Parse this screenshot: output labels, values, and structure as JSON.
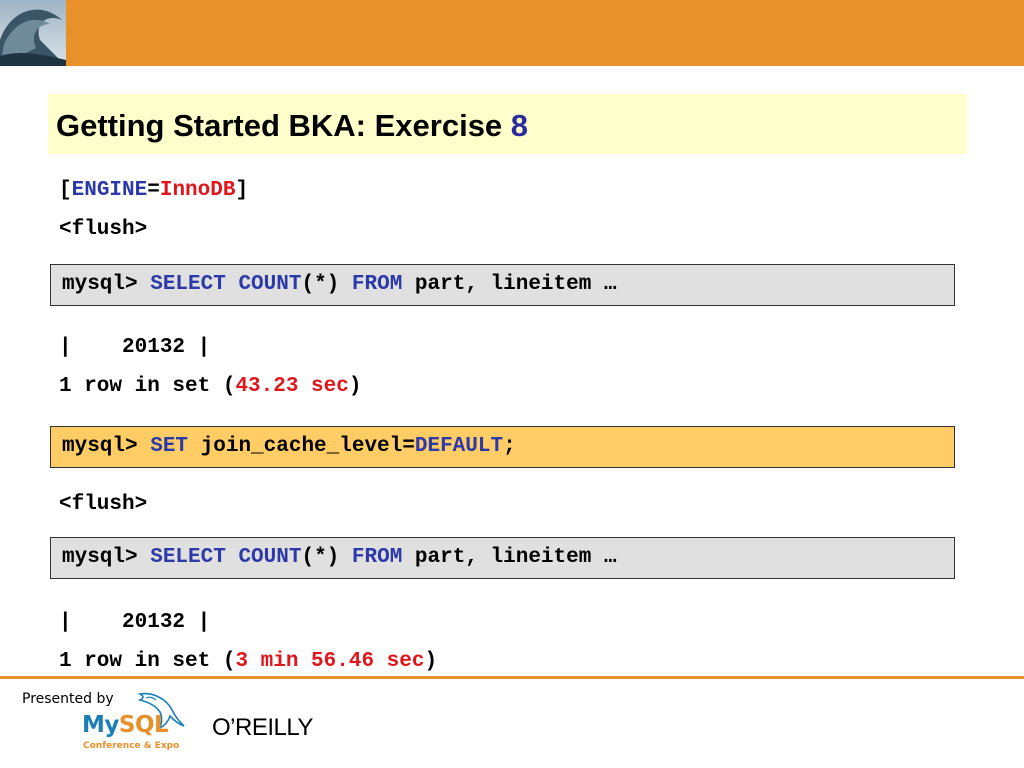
{
  "slide": {
    "title_text": "Getting Started BKA: Exercise ",
    "title_number": "8"
  },
  "lines": {
    "engine_open": "[",
    "engine_key": "ENGINE",
    "engine_eq": "=",
    "engine_val": "InnoDB",
    "engine_close": "]",
    "flush1": "<flush>",
    "result1_row": "|    20132 |",
    "result1_prefix": "1 row in set (",
    "result1_time": "43.23 sec",
    "result1_suffix": ")",
    "flush2": "<flush>",
    "result2_row": "|    20132 |",
    "result2_prefix": "1 row in set (",
    "result2_time": "3 min 56.46 sec",
    "result2_suffix": ")"
  },
  "cmd1": {
    "prompt": "mysql> ",
    "select": "SELECT",
    "sp1": " ",
    "count": "COUNT",
    "args": "(*) ",
    "from": "FROM",
    "rest": " part, lineitem …"
  },
  "cmd2": {
    "prompt": "mysql> ",
    "set": "SET",
    "mid": " join_cache_level=",
    "default": "DEFAULT",
    "semicolon": ";"
  },
  "cmd3": {
    "prompt": "mysql> ",
    "select": "SELECT",
    "sp1": " ",
    "count": "COUNT",
    "args": "(*) ",
    "from": "FROM",
    "rest": " part, lineitem …"
  },
  "footer": {
    "presented_by": "Presented by",
    "mysql_my": "My",
    "mysql_sql": "SQL",
    "mysql_sub": "Conference & Expo",
    "oreilly": "O’REILLY"
  },
  "colors": {
    "header_orange": "#e8902a",
    "title_bg": "#ffffcc",
    "keyword_blue": "#2b3aa8",
    "time_red": "#e0161c",
    "highlight_box": "#ffcc66",
    "command_box": "#e0e0e0"
  }
}
